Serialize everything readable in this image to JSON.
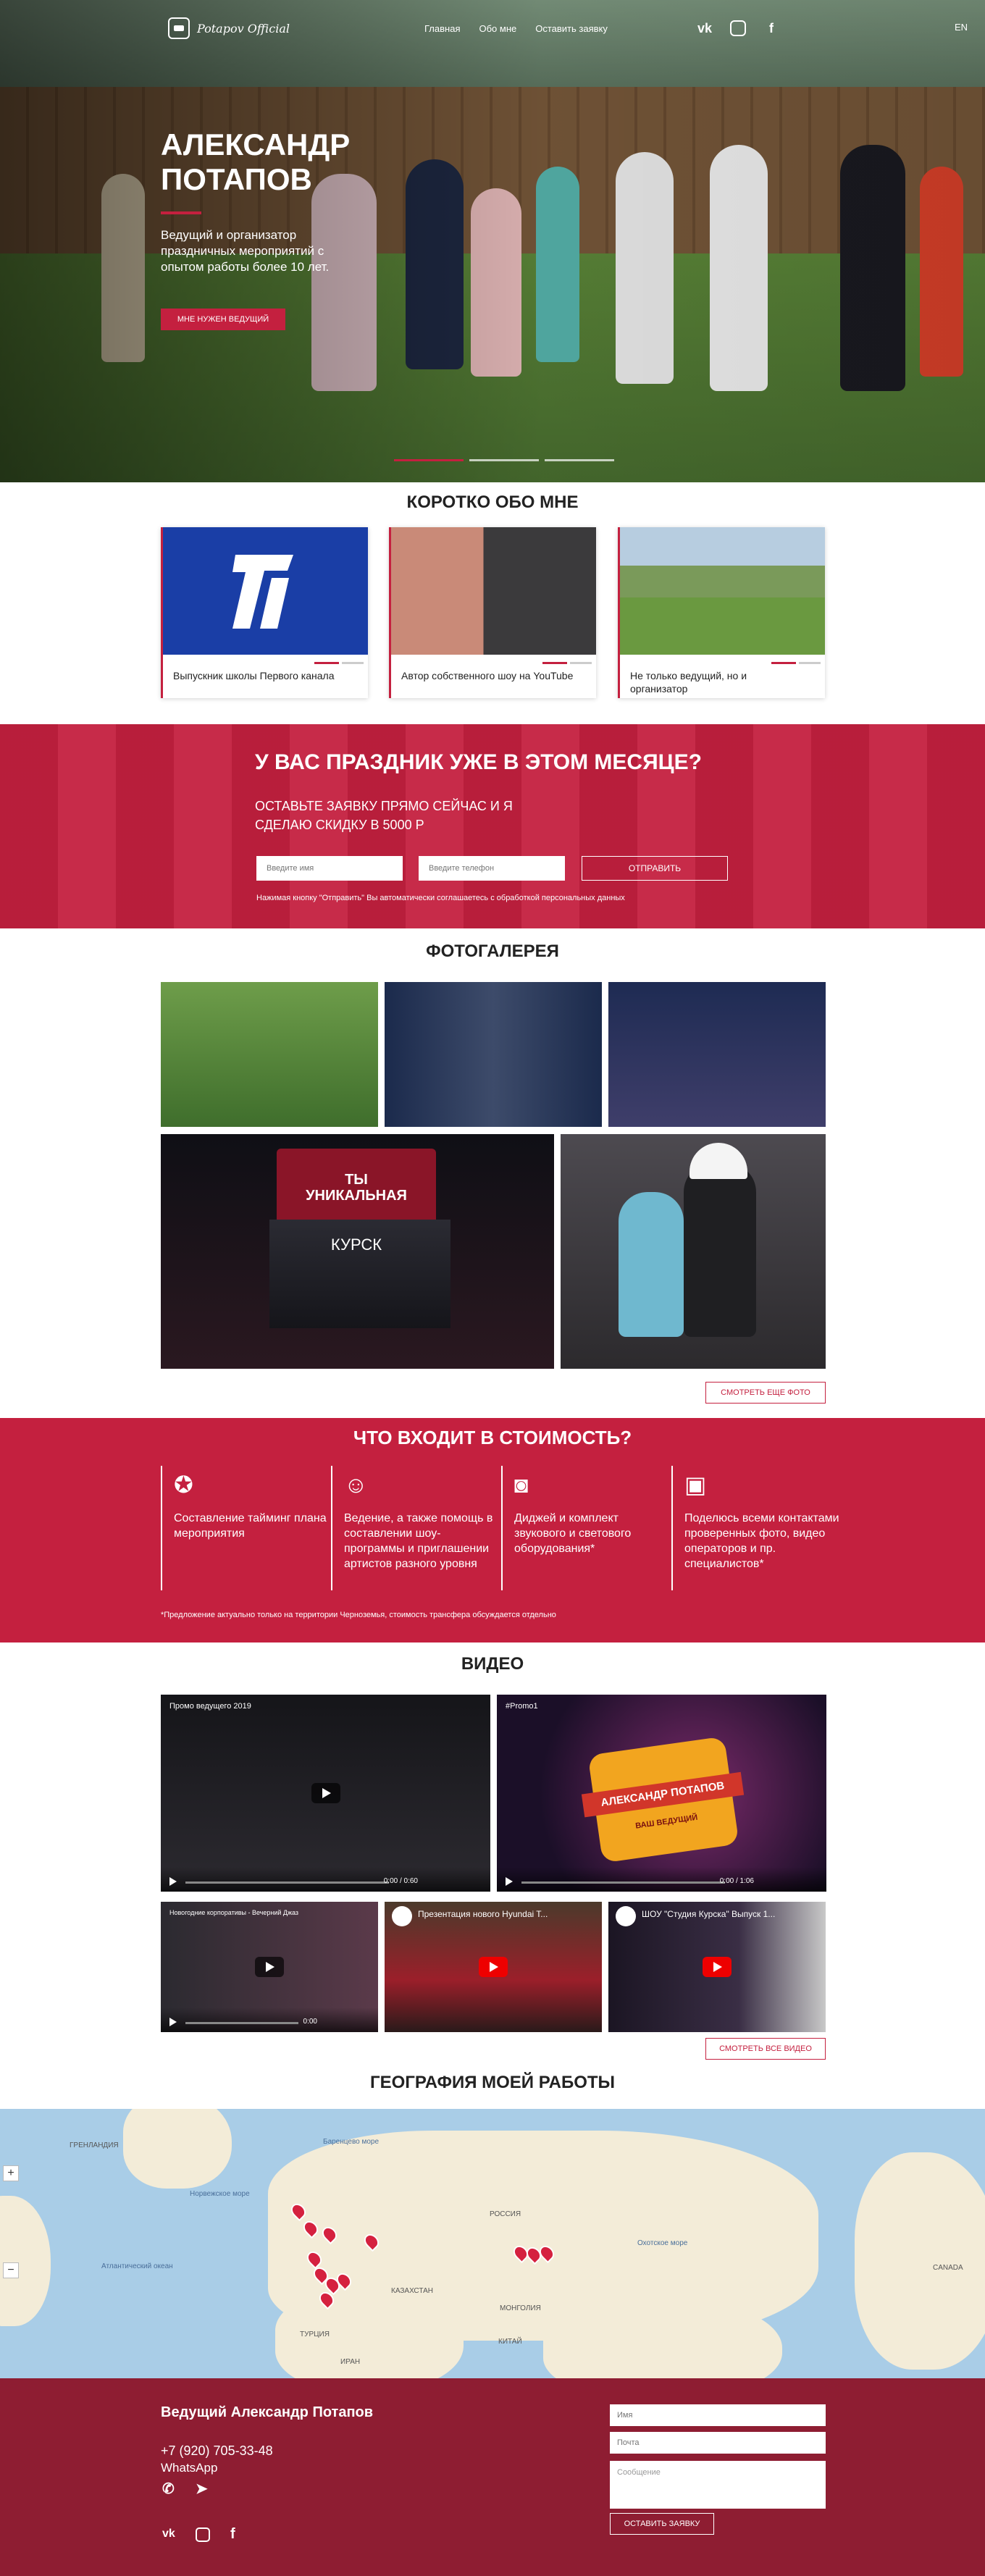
{
  "header": {
    "logo_text": "Potapov Official",
    "menu": [
      "Главная",
      "Обо мне",
      "Оставить заявку"
    ],
    "social": [
      "vk",
      "ig",
      "f"
    ],
    "lang": "EN"
  },
  "hero": {
    "title": "Александр Потапов",
    "subtitle": "Ведущий и организатор праздничных мероприятий с опытом работы более 10 лет.",
    "button": "Мне нужен ведущий"
  },
  "about": {
    "heading": "Коротко обо мне",
    "cards": [
      {
        "caption": "Выпускник школы Первого канала"
      },
      {
        "caption": "Автор собственного шоу на YouTube"
      },
      {
        "caption": "Не только ведущий, но и организатор"
      }
    ]
  },
  "promo": {
    "title": "У вас праздник уже в этом месяце?",
    "subtitle": "Оставьте заявку прямо сейчас и я сделаю скидку в 5000 р",
    "name_placeholder": "Введите имя",
    "phone_placeholder": "Введите телефон",
    "button": "Отправить",
    "note": "Нажимая кнопку \"Отправить\" Вы автоматически соглашаетесь с обработкой персональных данных"
  },
  "gallery": {
    "heading": "Фотогалерея",
    "more_button": "Смотреть еще фото",
    "photo_text": [
      "ТЫ",
      "УНИКАЛЬНАЯ",
      "КУРСК"
    ]
  },
  "price": {
    "heading": "Что входит в стоимость?",
    "items": [
      {
        "icon": "medal-icon",
        "text": "Составление тайминг плана мероприятия"
      },
      {
        "icon": "mask-icon",
        "text": "Ведение, а также помощь в составлении шоу-программы и приглашении артистов разного уровня"
      },
      {
        "icon": "speaker-icon",
        "text": "Диджей и комплект звукового и светового оборудования*"
      },
      {
        "icon": "photos-icon",
        "text": "Поделюсь всеми контактами проверенных фото, видео операторов и пр. специалистов*"
      }
    ],
    "note": "*Предложение актуально только на территории Черноземья, стоимость трансфера обсуждается отдельно"
  },
  "video": {
    "heading": "Видео",
    "videos": [
      {
        "title": "Промо ведущего 2019",
        "time": "0:00 / 0:60"
      },
      {
        "title": "#Promo1",
        "time": "0:00 / 1:06",
        "badge_top": "АЛЕКСАНДР ПОТАПОВ",
        "badge_bottom": "ВАШ ВЕДУЩИЙ"
      },
      {
        "title": "Новогодние корпоративы - Вечерний Джаз",
        "time": "0:00"
      },
      {
        "title": "Презентация нового Hyundai T...",
        "time": ""
      },
      {
        "title": "ШОУ \"Студия Курска\" Выпуск 1...",
        "time": ""
      }
    ],
    "more_button": "Смотреть все видео"
  },
  "map": {
    "heading": "География моей работы",
    "labels": [
      "ГРЕНЛАНДИЯ",
      "Норвежское море",
      "Баренцево море",
      "Атлантический океан",
      "РОССИЯ",
      "КАЗАХСТАН",
      "МОНГОЛИЯ",
      "КИТАЙ",
      "ТУРЦИЯ",
      "ИРАН",
      "CANADA",
      "Охотское море"
    ],
    "zoom_in": "+",
    "zoom_out": "−"
  },
  "footer": {
    "title": "Ведущий Александр Потапов",
    "phone": "+7 (920) 705-33-48",
    "whatsapp": "WhatsApp",
    "name_placeholder": "Имя",
    "email_placeholder": "Почта",
    "message_placeholder": "Сообщение",
    "button": "Оставить заявку"
  }
}
